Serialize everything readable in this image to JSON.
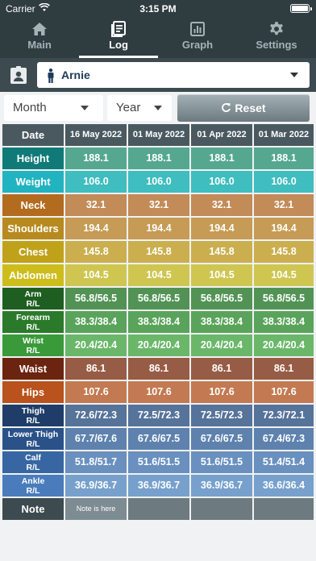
{
  "status": {
    "carrier": "Carrier",
    "time": "3:15 PM"
  },
  "tabs": [
    {
      "label": "Main",
      "icon": "home-icon"
    },
    {
      "label": "Log",
      "icon": "log-book-icon"
    },
    {
      "label": "Graph",
      "icon": "bar-chart-icon"
    },
    {
      "label": "Settings",
      "icon": "gear-icon"
    }
  ],
  "active_tab": "Log",
  "person": {
    "name": "Arnie"
  },
  "filters": {
    "month": "Month",
    "year": "Year",
    "reset_label": "Reset"
  },
  "table": {
    "date_label": "Date",
    "dates": [
      "16 May 2022",
      "01 May 2022",
      "01 Apr 2022",
      "01 Mar 2022"
    ],
    "rows": [
      {
        "label": "Height",
        "sub": "",
        "label_color": "#107a78",
        "value_color": "#55a790",
        "values": [
          "188.1",
          "188.1",
          "188.1",
          "188.1"
        ]
      },
      {
        "label": "Weight",
        "sub": "",
        "label_color": "#22b3c0",
        "value_color": "#3fbdbf",
        "values": [
          "106.0",
          "106.0",
          "106.0",
          "106.0"
        ]
      },
      {
        "label": "Neck",
        "sub": "",
        "label_color": "#b36b20",
        "value_color": "#c28b57",
        "values": [
          "32.1",
          "32.1",
          "32.1",
          "32.1"
        ]
      },
      {
        "label": "Shoulders",
        "sub": "",
        "label_color": "#b78a1f",
        "value_color": "#c69b55",
        "values": [
          "194.4",
          "194.4",
          "194.4",
          "194.4"
        ]
      },
      {
        "label": "Chest",
        "sub": "",
        "label_color": "#bfa21a",
        "value_color": "#cbaf4f",
        "values": [
          "145.8",
          "145.8",
          "145.8",
          "145.8"
        ]
      },
      {
        "label": "Abdomen",
        "sub": "",
        "label_color": "#cdbd1c",
        "value_color": "#cfc652",
        "values": [
          "104.5",
          "104.5",
          "104.5",
          "104.5"
        ]
      },
      {
        "label": "Arm",
        "sub": "R/L",
        "label_color": "#1e5e20",
        "value_color": "#529355",
        "values": [
          "56.8/56.5",
          "56.8/56.5",
          "56.8/56.5",
          "56.8/56.5"
        ]
      },
      {
        "label": "Forearm",
        "sub": "R/L",
        "label_color": "#2b7a2b",
        "value_color": "#5aa35b",
        "values": [
          "38.3/38.4",
          "38.3/38.4",
          "38.3/38.4",
          "38.3/38.4"
        ]
      },
      {
        "label": "Wrist",
        "sub": "R/L",
        "label_color": "#3a9a3a",
        "value_color": "#6ab76a",
        "values": [
          "20.4/20.4",
          "20.4/20.4",
          "20.4/20.4",
          "20.4/20.4"
        ]
      },
      {
        "label": "Waist",
        "sub": "",
        "label_color": "#6b2410",
        "value_color": "#975c45",
        "values": [
          "86.1",
          "86.1",
          "86.1",
          "86.1"
        ]
      },
      {
        "label": "Hips",
        "sub": "",
        "label_color": "#b9521d",
        "value_color": "#c37a52",
        "values": [
          "107.6",
          "107.6",
          "107.6",
          "107.6"
        ]
      },
      {
        "label": "Thigh",
        "sub": "R/L",
        "label_color": "#1f3d68",
        "value_color": "#56739a",
        "values": [
          "72.6/72.3",
          "72.5/72.3",
          "72.5/72.3",
          "72.3/72.1"
        ]
      },
      {
        "label": "Lower Thigh",
        "sub": "R/L",
        "label_color": "#2a5288",
        "value_color": "#5e82ad",
        "values": [
          "67.7/67.6",
          "67.6/67.5",
          "67.6/67.5",
          "67.4/67.3"
        ]
      },
      {
        "label": "Calf",
        "sub": "R/L",
        "label_color": "#3766a2",
        "value_color": "#6990bf",
        "values": [
          "51.8/51.7",
          "51.6/51.5",
          "51.6/51.5",
          "51.4/51.4"
        ]
      },
      {
        "label": "Ankle",
        "sub": "R/L",
        "label_color": "#4a7cbb",
        "value_color": "#77a0cc",
        "values": [
          "36.9/36.7",
          "36.9/36.7",
          "36.9/36.7",
          "36.6/36.4"
        ]
      }
    ],
    "note_label": "Note",
    "notes": [
      "Note is here",
      "",
      "",
      ""
    ]
  }
}
